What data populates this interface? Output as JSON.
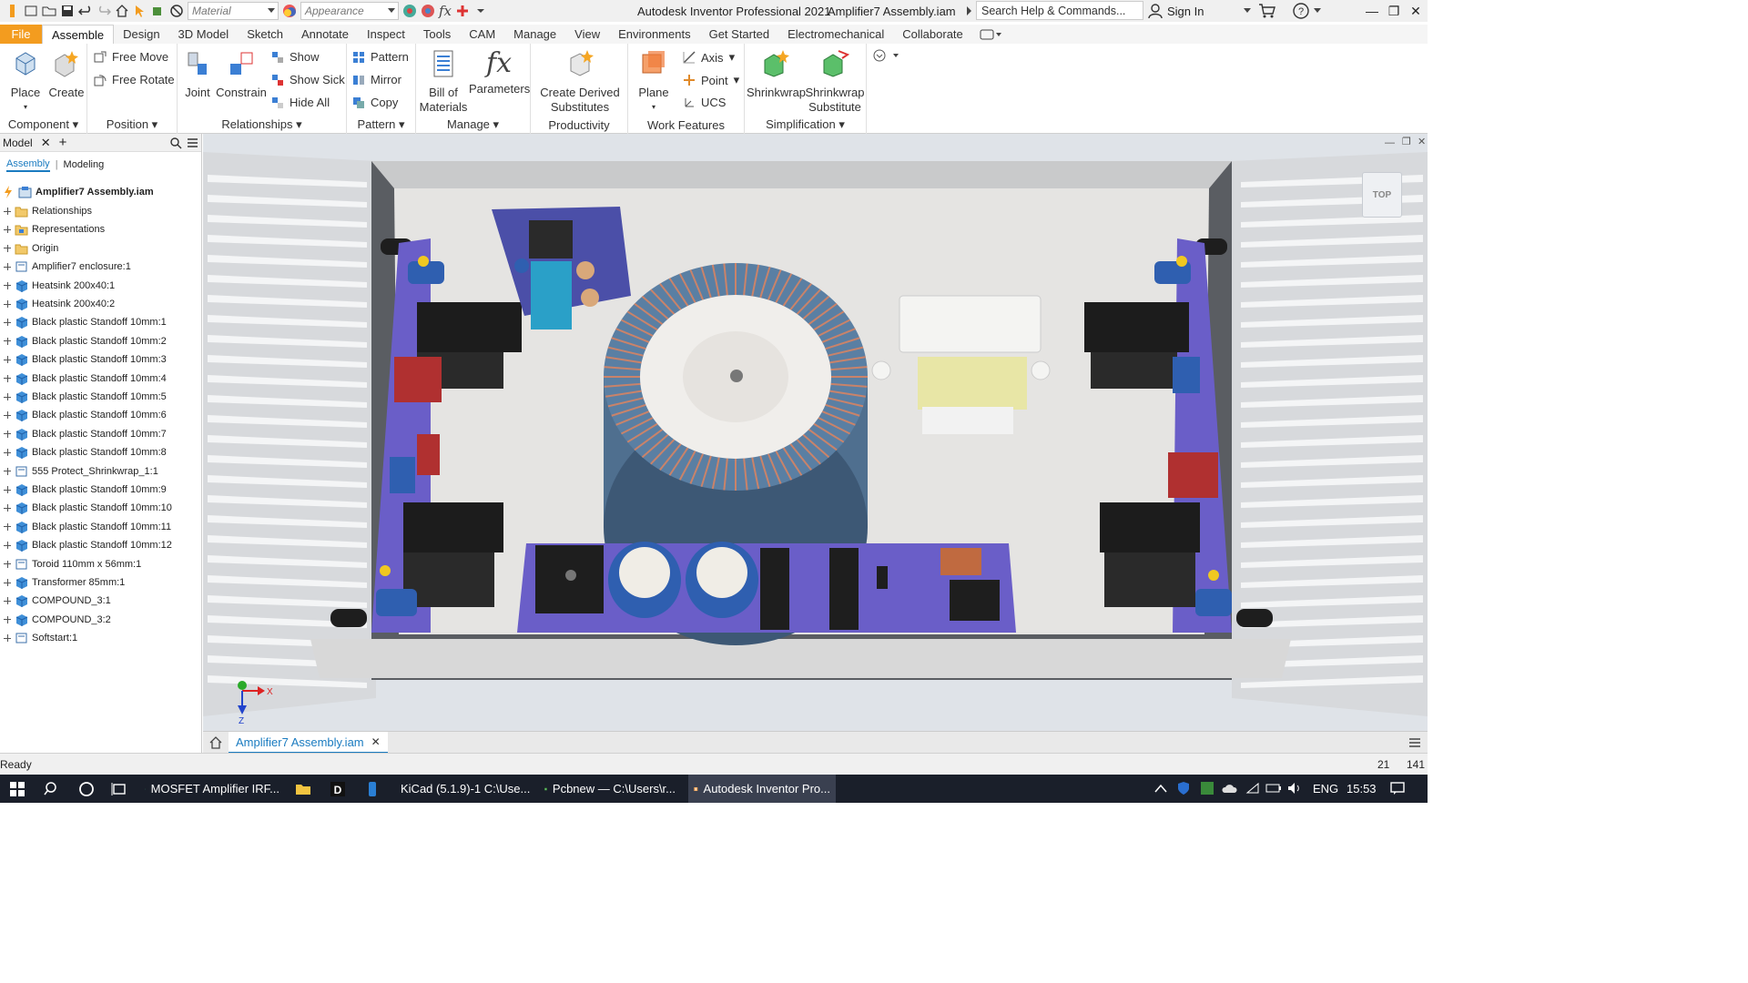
{
  "titlebar": {
    "material": "Material",
    "appearance": "Appearance",
    "app_title": "Autodesk Inventor Professional 2021",
    "doc_title": "Amplifier7 Assembly.iam",
    "search_placeholder": "Search Help & Commands...",
    "sign_in": "Sign In",
    "fx_label": "fx"
  },
  "tabs": [
    "File",
    "Assemble",
    "Design",
    "3D Model",
    "Sketch",
    "Annotate",
    "Inspect",
    "Tools",
    "CAM",
    "Manage",
    "View",
    "Environments",
    "Get Started",
    "Electromechanical",
    "Collaborate"
  ],
  "ribbon": {
    "component": {
      "label": "Component",
      "place": "Place",
      "create": "Create"
    },
    "position": {
      "label": "Position",
      "free_move": "Free Move",
      "free_rotate": "Free Rotate"
    },
    "relationships": {
      "label": "Relationships",
      "joint": "Joint",
      "constrain": "Constrain",
      "show": "Show",
      "show_sick": "Show Sick",
      "hide_all": "Hide All"
    },
    "pattern": {
      "label": "Pattern",
      "pattern": "Pattern",
      "mirror": "Mirror",
      "copy": "Copy"
    },
    "manage": {
      "label": "Manage",
      "bom_line1": "Bill of",
      "bom_line2": "Materials",
      "parameters": "Parameters",
      "fx": "fx"
    },
    "productivity": {
      "label": "Productivity",
      "line1": "Create Derived",
      "line2": "Substitutes"
    },
    "work_features": {
      "label": "Work Features",
      "plane": "Plane",
      "axis": "Axis",
      "point": "Point",
      "ucs": "UCS"
    },
    "simplification": {
      "label": "Simplification",
      "shrinkwrap": "Shrinkwrap",
      "sub_line1": "Shrinkwrap",
      "sub_line2": "Substitute"
    }
  },
  "browser": {
    "title": "Model",
    "tab_assembly": "Assembly",
    "tab_modeling": "Modeling",
    "root": "Amplifier7 Assembly.iam",
    "items": [
      {
        "label": "Relationships",
        "icon": "folder"
      },
      {
        "label": "Representations",
        "icon": "representations"
      },
      {
        "label": "Origin",
        "icon": "folder"
      },
      {
        "label": "Amplifier7 enclosure:1",
        "icon": "subassembly"
      },
      {
        "label": "Heatsink 200x40:1",
        "icon": "part"
      },
      {
        "label": "Heatsink 200x40:2",
        "icon": "part"
      },
      {
        "label": "Black plastic Standoff 10mm:1",
        "icon": "part"
      },
      {
        "label": "Black plastic Standoff 10mm:2",
        "icon": "part"
      },
      {
        "label": "Black plastic Standoff 10mm:3",
        "icon": "part"
      },
      {
        "label": "Black plastic Standoff 10mm:4",
        "icon": "part"
      },
      {
        "label": "Black plastic Standoff 10mm:5",
        "icon": "part"
      },
      {
        "label": "Black plastic Standoff 10mm:6",
        "icon": "part"
      },
      {
        "label": "Black plastic Standoff 10mm:7",
        "icon": "part"
      },
      {
        "label": "Black plastic Standoff 10mm:8",
        "icon": "part"
      },
      {
        "label": "555 Protect_Shrinkwrap_1:1",
        "icon": "subassembly"
      },
      {
        "label": "Black plastic Standoff 10mm:9",
        "icon": "part"
      },
      {
        "label": "Black plastic Standoff 10mm:10",
        "icon": "part"
      },
      {
        "label": "Black plastic Standoff 10mm:11",
        "icon": "part"
      },
      {
        "label": "Black plastic Standoff 10mm:12",
        "icon": "part"
      },
      {
        "label": "Toroid 110mm x 56mm:1",
        "icon": "subassembly"
      },
      {
        "label": "Transformer 85mm:1",
        "icon": "part"
      },
      {
        "label": "COMPOUND_3:1",
        "icon": "part"
      },
      {
        "label": "COMPOUND_3:2",
        "icon": "part"
      },
      {
        "label": "Softstart:1",
        "icon": "subassembly"
      }
    ]
  },
  "viewport": {
    "viewcube": "TOP",
    "axis_x": "X",
    "axis_z": "Z"
  },
  "doc_tab": "Amplifier7 Assembly.iam",
  "status": {
    "text": "Ready",
    "n1": "21",
    "n2": "141"
  },
  "taskbar": {
    "items": [
      "MOSFET Amplifier IRF...",
      "KiCad (5.1.9)-1 C:\\Use...",
      "Pcbnew — C:\\Users\\r...",
      "Autodesk Inventor Pro..."
    ],
    "lang": "ENG",
    "time": "15:53"
  },
  "colors": {
    "file_tab": "#f39c1f",
    "pcb": "#6a5ec8",
    "heatsink": "#e8e8e8",
    "toroid": "#5a7fa3"
  }
}
